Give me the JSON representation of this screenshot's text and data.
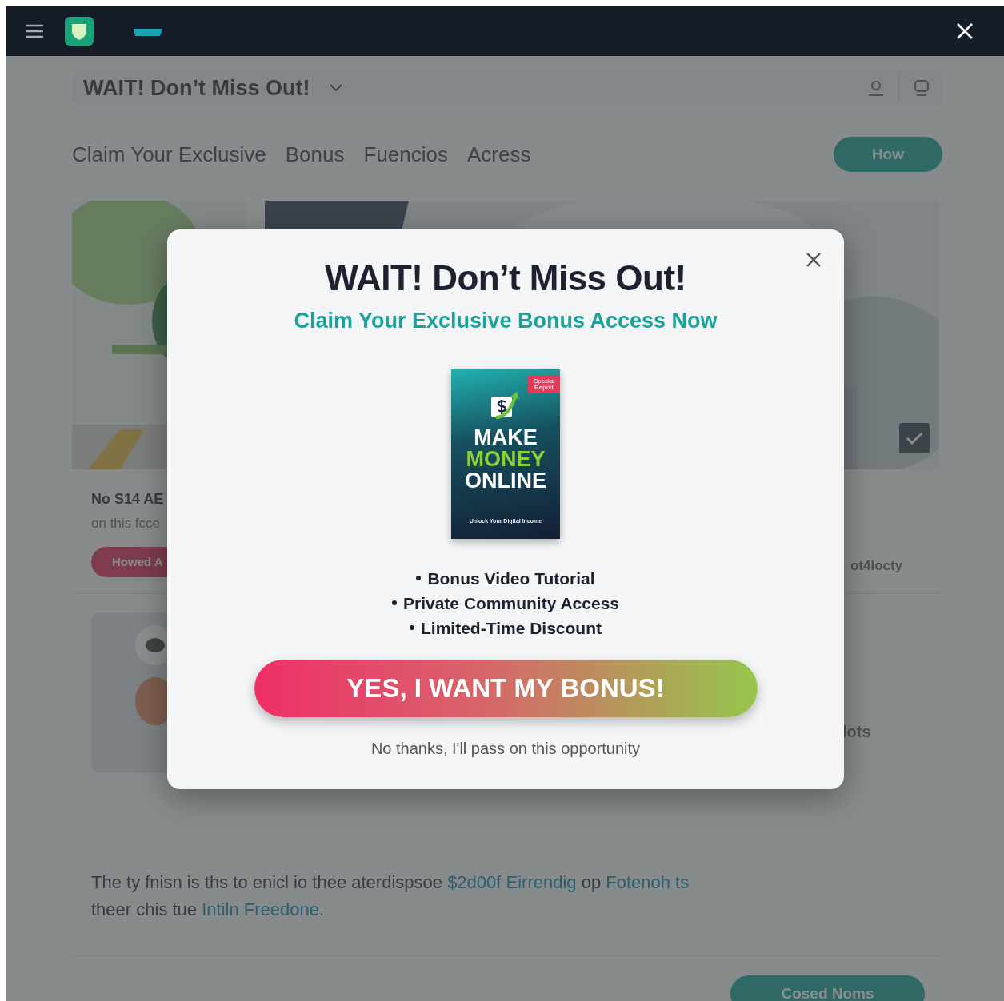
{
  "header": {
    "title": "WAIT! Don’t Miss Out!"
  },
  "nav": {
    "items": [
      "Claim Your Exclusive",
      "Bonus",
      "Fuencios",
      "Acress"
    ],
    "button": "How"
  },
  "card": {
    "title": "No S14 AE",
    "subtitle": "on this fcce",
    "button": "Howed A"
  },
  "side_texts": [
    "ot4locty",
    "lots"
  ],
  "paragraph": [
    {
      "text": "The ty fnisn is ths to enicl io thee aterdispsoe ",
      "link": false
    },
    {
      "text": "$2d00f Eirrendig",
      "link": true
    },
    {
      "text": " op ",
      "link": false
    },
    {
      "text": "Fotenoh ts",
      "link": true
    },
    {
      "text": " theer chis tue ",
      "link": false
    },
    {
      "text": "Intiln Freedone",
      "link": true
    },
    {
      "text": ".",
      "link": false
    }
  ],
  "footer_button": "Cosed Noms",
  "modal": {
    "title": "WAIT! Don’t Miss Out!",
    "subtitle": "Claim Your Exclusive Bonus Access Now",
    "cover": {
      "badge": "Special Report",
      "lines": [
        {
          "text": "MAKE",
          "accent": false
        },
        {
          "text": "MONEY",
          "accent": true
        },
        {
          "text": "ONLINE",
          "accent": false
        }
      ],
      "tagline": "Unlock Your Digital Income"
    },
    "bullets": [
      "Bonus Video Tutorial",
      "Private Community Access",
      "Limited-Time Discount"
    ],
    "cta": "YES, I WANT MY BONUS!",
    "decline": "No thanks, I'll pass on this opportunity"
  }
}
